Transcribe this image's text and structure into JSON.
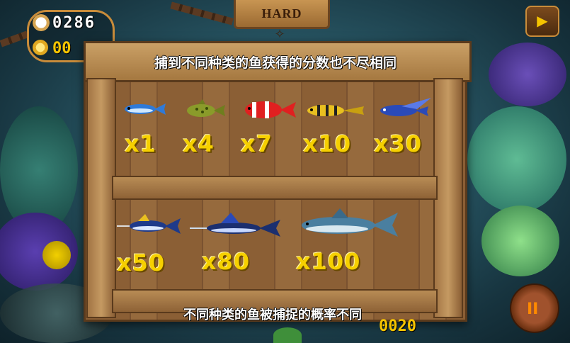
{
  "hud": {
    "timer": "0286",
    "coins": "00",
    "difficulty": "HARD",
    "score": "0020"
  },
  "panel": {
    "headline": "捕到不同种类的鱼获得的分数也不尽相同",
    "footline": "不同种类的鱼被捕捉的概率不同",
    "row1": [
      {
        "multiplier": "x1",
        "fish": "small-blue-fish"
      },
      {
        "multiplier": "x4",
        "fish": "spotted-green-fish"
      },
      {
        "multiplier": "x7",
        "fish": "clownfish"
      },
      {
        "multiplier": "x10",
        "fish": "yellow-striped-fish"
      },
      {
        "multiplier": "x30",
        "fish": "blue-winged-fish"
      }
    ],
    "row2": [
      {
        "multiplier": "x50",
        "fish": "swordfish"
      },
      {
        "multiplier": "x80",
        "fish": "marlin"
      },
      {
        "multiplier": "x100",
        "fish": "shark"
      }
    ]
  },
  "icons": {
    "timer": "clock-icon",
    "coins": "coin-stack-icon",
    "sound": "sound-toggle-icon",
    "pause": "pause-icon",
    "sign": "fish-bone-icon"
  }
}
